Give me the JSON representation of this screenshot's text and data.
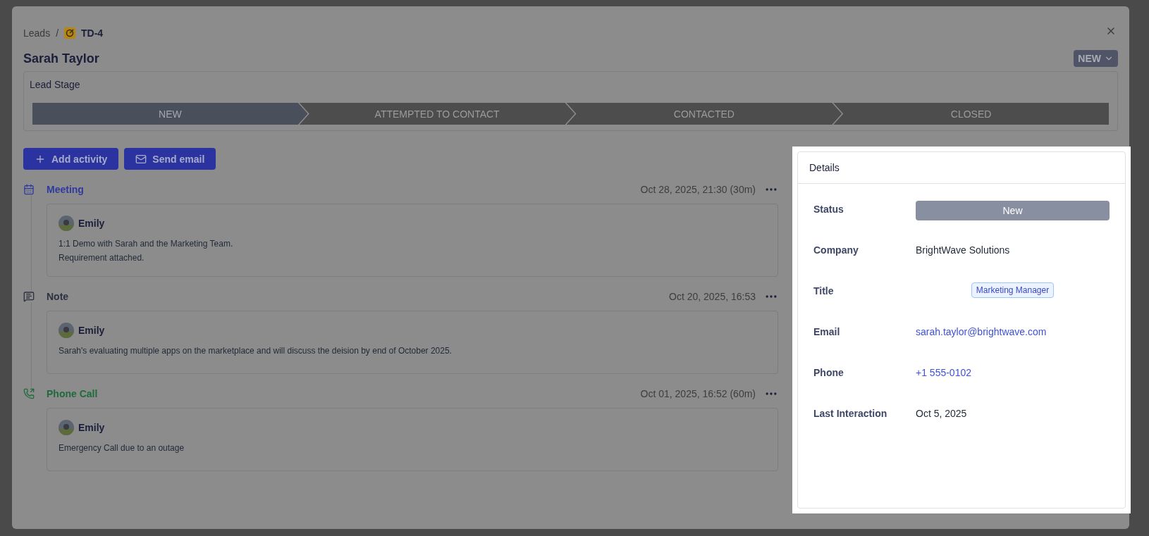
{
  "breadcrumb": {
    "parent": "Leads",
    "separator": "/",
    "current": "TD-4"
  },
  "lead_name": "Sarah Taylor",
  "status_dropdown": {
    "label": "NEW"
  },
  "lead_stage": {
    "title": "Lead Stage",
    "stages": [
      {
        "label": "NEW",
        "selected": true
      },
      {
        "label": "ATTEMPTED TO CONTACT",
        "selected": false
      },
      {
        "label": "CONTACTED",
        "selected": false
      },
      {
        "label": "CLOSED",
        "selected": false
      }
    ]
  },
  "actions": [
    {
      "kind": "add",
      "label": "Add activity"
    },
    {
      "kind": "email",
      "label": "Send email"
    }
  ],
  "activities": [
    {
      "kind": "meeting",
      "title": "Meeting",
      "time": "Oct 28, 2025, 21:30 (30m)",
      "author": "Emily",
      "lines": [
        "1:1 Demo with Sarah and the Marketing Team.",
        "Requirement attached."
      ]
    },
    {
      "kind": "note",
      "title": "Note",
      "time": "Oct 20, 2025, 16:53",
      "author": "Emily",
      "lines": [
        "Sarah's evaluating multiple apps on the marketplace and will discuss the deision by end of October 2025."
      ]
    },
    {
      "kind": "call",
      "title": "Phone Call",
      "time": "Oct 01, 2025, 16:52 (60m)",
      "author": "Emily",
      "lines": [
        "Emergency Call due to an outage"
      ]
    }
  ],
  "details": {
    "title": "Details",
    "fields": [
      {
        "kind": "status",
        "label": "Status",
        "value": "New"
      },
      {
        "kind": "text",
        "label": "Company",
        "value": "BrightWave Solutions"
      },
      {
        "kind": "tag",
        "label": "Title",
        "value": "Marketing Manager"
      },
      {
        "kind": "link",
        "label": "Email",
        "value": "sarah.taylor@brightwave.com"
      },
      {
        "kind": "link",
        "label": "Phone",
        "value": "+1 555-0102"
      },
      {
        "kind": "text",
        "label": "Last Interaction",
        "value": "Oct 5, 2025"
      }
    ]
  }
}
